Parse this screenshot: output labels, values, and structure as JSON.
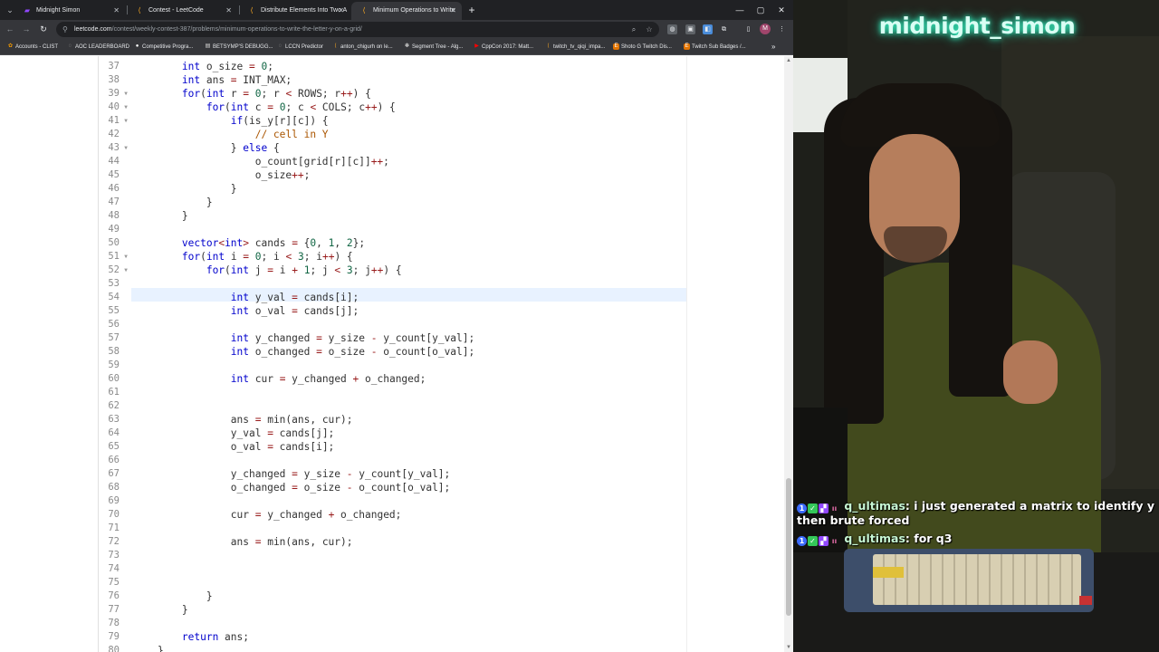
{
  "browser": {
    "tabs": [
      {
        "label": "Midnight Simon",
        "icon": "twitch-icon"
      },
      {
        "label": "Contest - LeetCode",
        "icon": "leetcode-icon"
      },
      {
        "label": "Distribute Elements Into Two A",
        "icon": "leetcode-icon"
      },
      {
        "label": "Minimum Operations to Write",
        "icon": "leetcode-icon"
      }
    ],
    "url_domain": "leetcode.com",
    "url_path": "/contest/weekly-contest-387/problems/minimum-operations-to-write-the-letter-y-on-a-grid/",
    "profile_initial": "M",
    "bookmarks": [
      "Accounts - CLIST",
      "AOC LEADERBOARD",
      "Competitive Progra...",
      "BETSYMP'S DEBUGG...",
      "LCCN Predictor",
      "anton_chigurh on le...",
      "Segment Tree - Alg...",
      "CppCon 2017: Matt...",
      "twitch_tv_qiqi_impa...",
      "Shoto G Twitch Dis...",
      "Twitch Sub Badges /..."
    ]
  },
  "editor": {
    "highlighted_line": 54,
    "lines": [
      {
        "n": 37,
        "fold": "",
        "code": "        int o_size = 0;"
      },
      {
        "n": 38,
        "fold": "",
        "code": "        int ans = INT_MAX;"
      },
      {
        "n": 39,
        "fold": "▼",
        "code": "        for(int r = 0; r < ROWS; r++) {"
      },
      {
        "n": 40,
        "fold": "▼",
        "code": "            for(int c = 0; c < COLS; c++) {"
      },
      {
        "n": 41,
        "fold": "▼",
        "code": "                if(is_y[r][c]) {"
      },
      {
        "n": 42,
        "fold": "",
        "code": "                    // cell in Y"
      },
      {
        "n": 43,
        "fold": "▼",
        "code": "                } else {"
      },
      {
        "n": 44,
        "fold": "",
        "code": "                    o_count[grid[r][c]]++;"
      },
      {
        "n": 45,
        "fold": "",
        "code": "                    o_size++;"
      },
      {
        "n": 46,
        "fold": "",
        "code": "                }"
      },
      {
        "n": 47,
        "fold": "",
        "code": "            }"
      },
      {
        "n": 48,
        "fold": "",
        "code": "        }"
      },
      {
        "n": 49,
        "fold": "",
        "code": ""
      },
      {
        "n": 50,
        "fold": "",
        "code": "        vector<int> cands = {0, 1, 2};"
      },
      {
        "n": 51,
        "fold": "▼",
        "code": "        for(int i = 0; i < 3; i++) {"
      },
      {
        "n": 52,
        "fold": "▼",
        "code": "            for(int j = i + 1; j < 3; j++) {"
      },
      {
        "n": 53,
        "fold": "",
        "code": ""
      },
      {
        "n": 54,
        "fold": "",
        "code": "                int y_val = cands[i];"
      },
      {
        "n": 55,
        "fold": "",
        "code": "                int o_val = cands[j];"
      },
      {
        "n": 56,
        "fold": "",
        "code": ""
      },
      {
        "n": 57,
        "fold": "",
        "code": "                int y_changed = y_size - y_count[y_val];"
      },
      {
        "n": 58,
        "fold": "",
        "code": "                int o_changed = o_size - o_count[o_val];"
      },
      {
        "n": 59,
        "fold": "",
        "code": ""
      },
      {
        "n": 60,
        "fold": "",
        "code": "                int cur = y_changed + o_changed;"
      },
      {
        "n": 61,
        "fold": "",
        "code": ""
      },
      {
        "n": 62,
        "fold": "",
        "code": ""
      },
      {
        "n": 63,
        "fold": "",
        "code": "                ans = min(ans, cur);"
      },
      {
        "n": 64,
        "fold": "",
        "code": "                y_val = cands[j];"
      },
      {
        "n": 65,
        "fold": "",
        "code": "                o_val = cands[i];"
      },
      {
        "n": 66,
        "fold": "",
        "code": ""
      },
      {
        "n": 67,
        "fold": "",
        "code": "                y_changed = y_size - y_count[y_val];"
      },
      {
        "n": 68,
        "fold": "",
        "code": "                o_changed = o_size - o_count[o_val];"
      },
      {
        "n": 69,
        "fold": "",
        "code": ""
      },
      {
        "n": 70,
        "fold": "",
        "code": "                cur = y_changed + o_changed;"
      },
      {
        "n": 71,
        "fold": "",
        "code": ""
      },
      {
        "n": 72,
        "fold": "",
        "code": "                ans = min(ans, cur);"
      },
      {
        "n": 73,
        "fold": "",
        "code": ""
      },
      {
        "n": 74,
        "fold": "",
        "code": ""
      },
      {
        "n": 75,
        "fold": "",
        "code": ""
      },
      {
        "n": 76,
        "fold": "",
        "code": "            }"
      },
      {
        "n": 77,
        "fold": "",
        "code": "        }"
      },
      {
        "n": 78,
        "fold": "",
        "code": ""
      },
      {
        "n": 79,
        "fold": "",
        "code": "        return ans;"
      },
      {
        "n": 80,
        "fold": "",
        "code": "    }"
      }
    ]
  },
  "stream": {
    "channel_name": "midnight_simon",
    "chat": [
      {
        "user": "q_ultimas",
        "message": "i just generated a matrix to identify y then brute forced"
      },
      {
        "user": "q_ultimas",
        "message": "for q3"
      }
    ]
  },
  "colors": {
    "keyword": "#0000cc",
    "number": "#116644",
    "comment": "#aa5500",
    "line_highlight": "#e8f2ff",
    "logo_glow": "#3dffcf"
  }
}
